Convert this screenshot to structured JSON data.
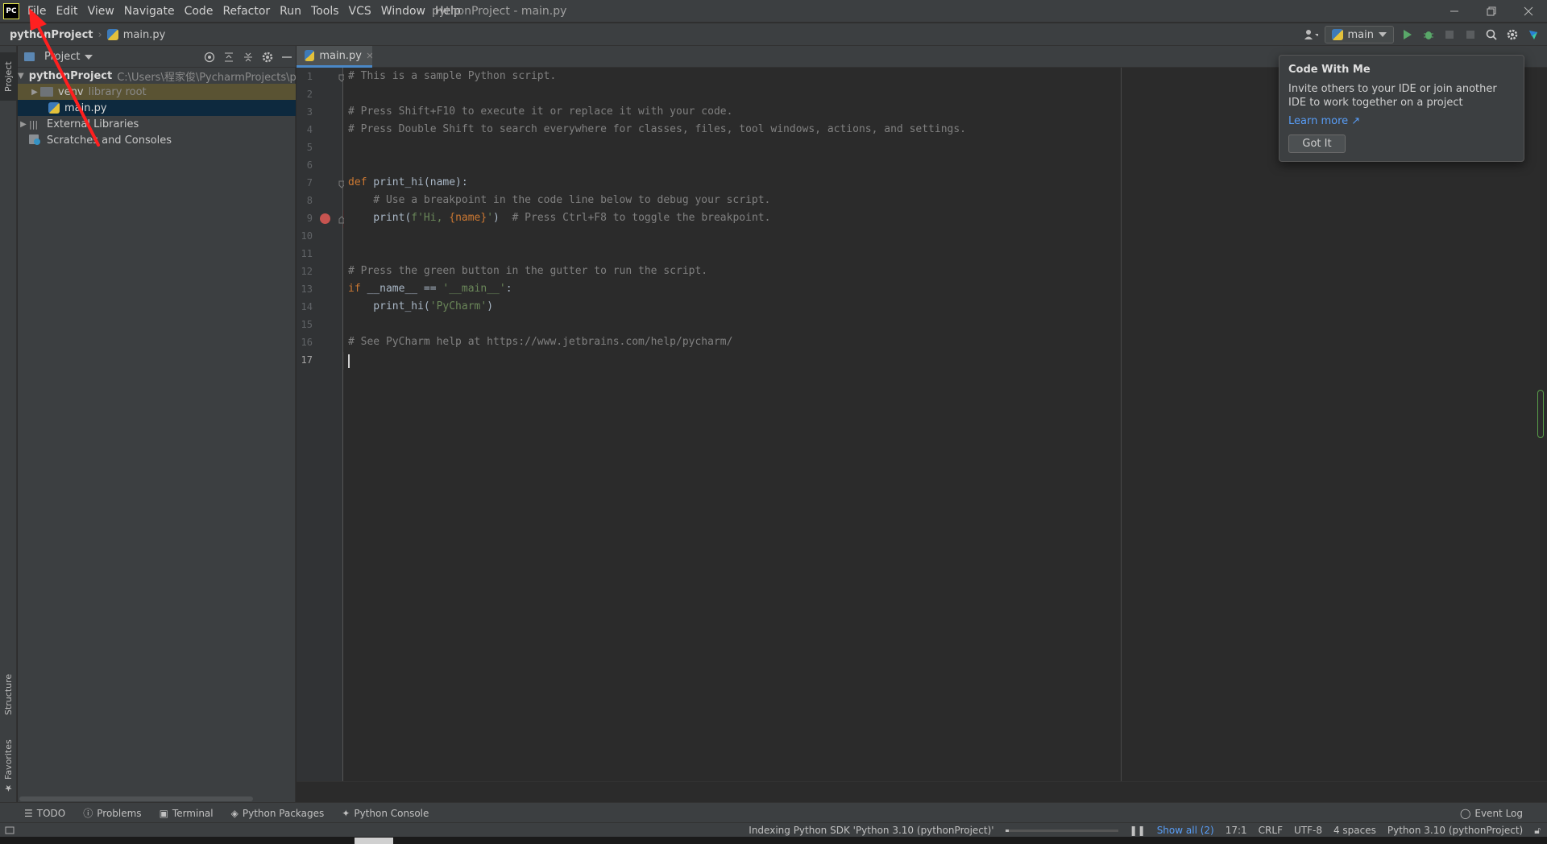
{
  "app": {
    "logo_text": "PC",
    "window_title": "pythonProject - main.py"
  },
  "menu": [
    "File",
    "Edit",
    "View",
    "Navigate",
    "Code",
    "Refactor",
    "Run",
    "Tools",
    "VCS",
    "Window",
    "Help"
  ],
  "navbar": {
    "project": "pythonProject",
    "file": "main.py",
    "run_config": "main"
  },
  "stripe": {
    "project": "Project",
    "structure": "Structure",
    "favorites": "Favorites"
  },
  "project_panel": {
    "title": "Project",
    "tree": [
      {
        "label": "pythonProject",
        "hint": "C:\\Users\\程家俊\\PycharmProjects\\pythonProject"
      },
      {
        "label": "venv",
        "hint": "library root"
      },
      {
        "label": "main.py"
      },
      {
        "label": "External Libraries"
      },
      {
        "label": "Scratches and Consoles"
      }
    ]
  },
  "editor": {
    "tab": "main.py",
    "line_numbers": [
      "1",
      "2",
      "3",
      "4",
      "5",
      "6",
      "7",
      "8",
      "9",
      "10",
      "11",
      "12",
      "13",
      "14",
      "15",
      "16",
      "17"
    ],
    "code": {
      "l1": "# This is a sample Python script.",
      "l3": "# Press Shift+F10 to execute it or replace it with your code.",
      "l4": "# Press Double Shift to search everywhere for classes, files, tool windows, actions, and settings.",
      "l7_kw": "def",
      "l7_rest": " print_hi(name):",
      "l8": "    # Use a breakpoint in the code line below to debug your script.",
      "l9_a": "    print(",
      "l9_str1": "f'Hi, ",
      "l9_name": "{name}",
      "l9_str2": "'",
      "l9_b": ")  ",
      "l9_comment": "# Press Ctrl+F8 to toggle the breakpoint.",
      "l12": "# Press the green button in the gutter to run the script.",
      "l13_kw": "if",
      "l13_rest": " __name__ == ",
      "l13_str": "'__main__'",
      "l13_end": ":",
      "l14_a": "    print_hi(",
      "l14_str": "'PyCharm'",
      "l14_b": ")",
      "l16": "# See PyCharm help at https://www.jetbrains.com/help/pycharm/"
    }
  },
  "popup": {
    "title": "Code With Me",
    "body": "Invite others to your IDE or join another IDE to work together on a project",
    "link": "Learn more ↗",
    "button": "Got It"
  },
  "tool_windows": [
    "TODO",
    "Problems",
    "Terminal",
    "Python Packages",
    "Python Console"
  ],
  "event_log": "Event Log",
  "status": {
    "indexing": "Indexing Python SDK 'Python 3.10 (pythonProject)'",
    "progress": 0.03,
    "show_all": "Show all (2)",
    "position": "17:1",
    "line_sep": "CRLF",
    "encoding": "UTF-8",
    "indent": "4 spaces",
    "interpreter": "Python 3.10 (pythonProject)"
  },
  "colors": {
    "accent": "#4a88c7",
    "breakpoint": "#c75450",
    "annotation": "#ff2020",
    "run_green": "#59a869"
  }
}
